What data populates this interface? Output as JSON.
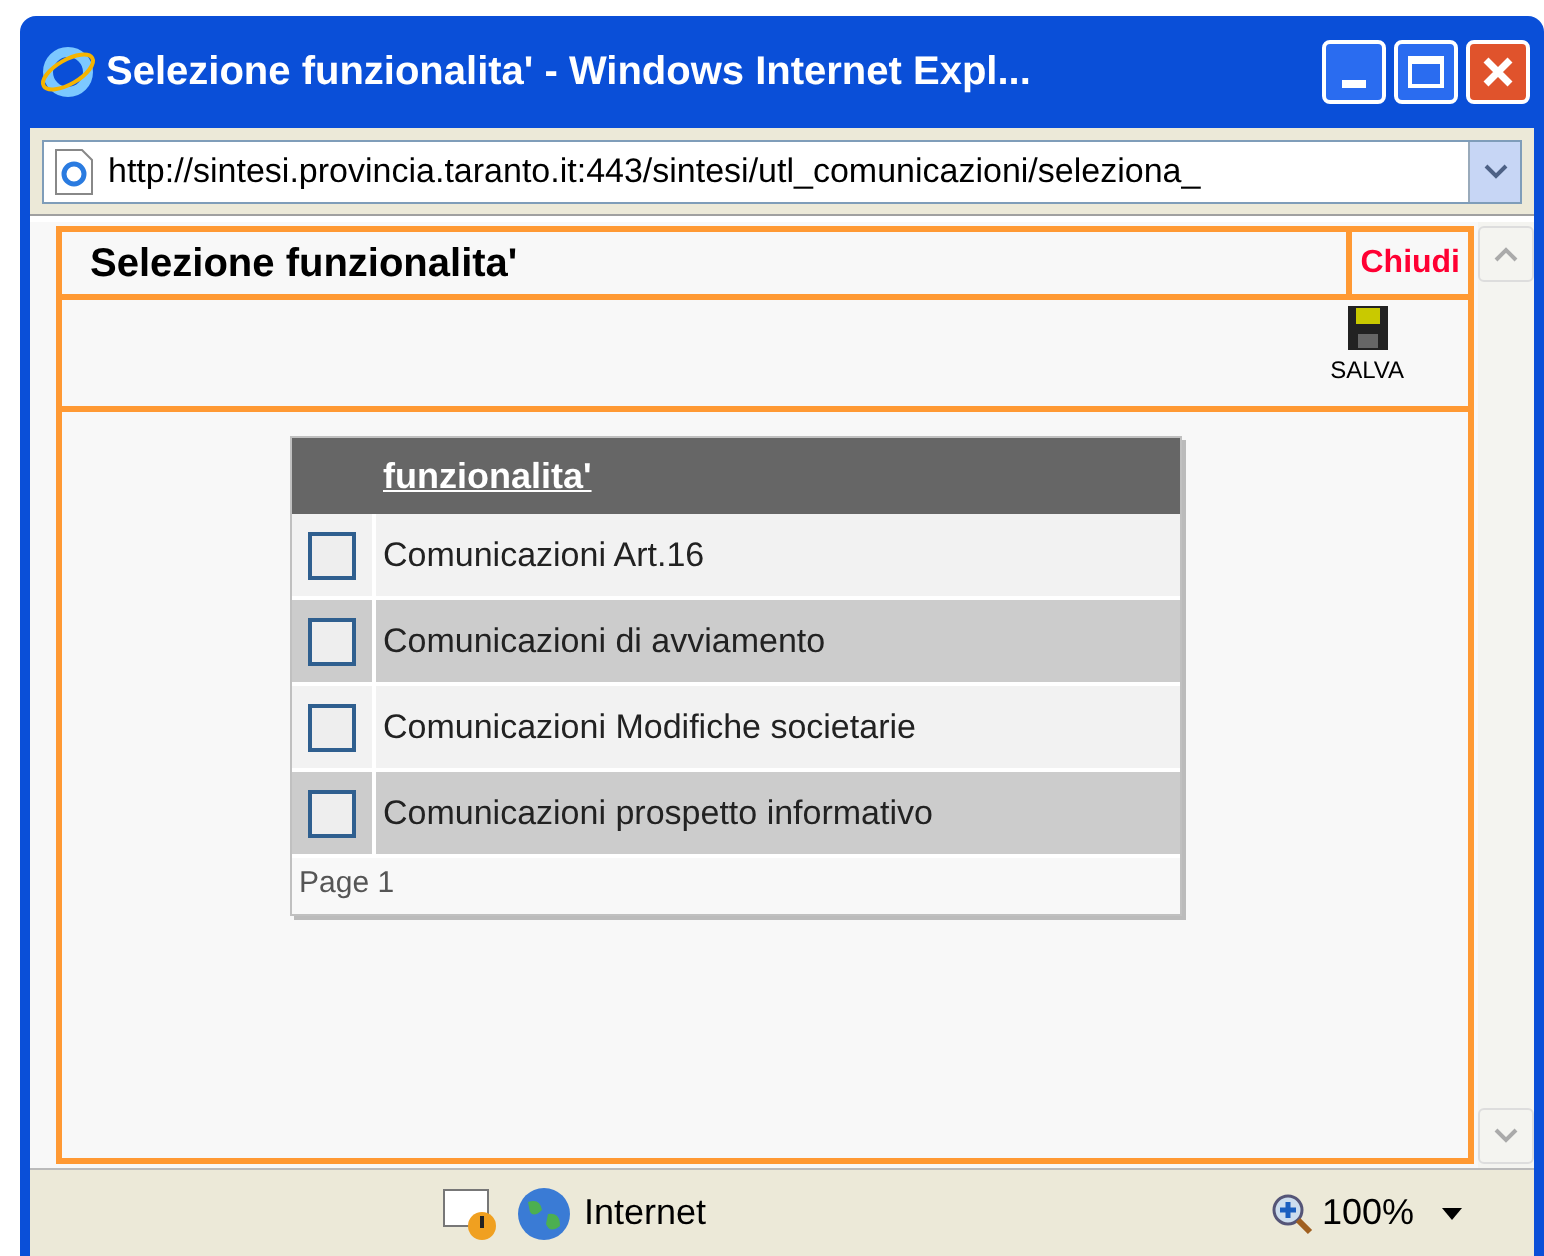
{
  "window": {
    "title": "Selezione funzionalita' - Windows Internet Expl..."
  },
  "address_bar": {
    "url": "http://sintesi.provincia.taranto.it:443/sintesi/utl_comunicazioni/seleziona_"
  },
  "page": {
    "heading": "Selezione funzionalita'",
    "close_link": "Chiudi",
    "save_button": "SALVA"
  },
  "table": {
    "column": "funzionalita'",
    "rows": [
      {
        "label": "Comunicazioni Art.16",
        "checked": false
      },
      {
        "label": "Comunicazioni di avviamento",
        "checked": false
      },
      {
        "label": "Comunicazioni Modifiche societarie",
        "checked": false
      },
      {
        "label": "Comunicazioni prospetto informativo",
        "checked": false
      }
    ],
    "pager": "Page 1"
  },
  "status_bar": {
    "zone": "Internet",
    "zoom": "100%"
  }
}
